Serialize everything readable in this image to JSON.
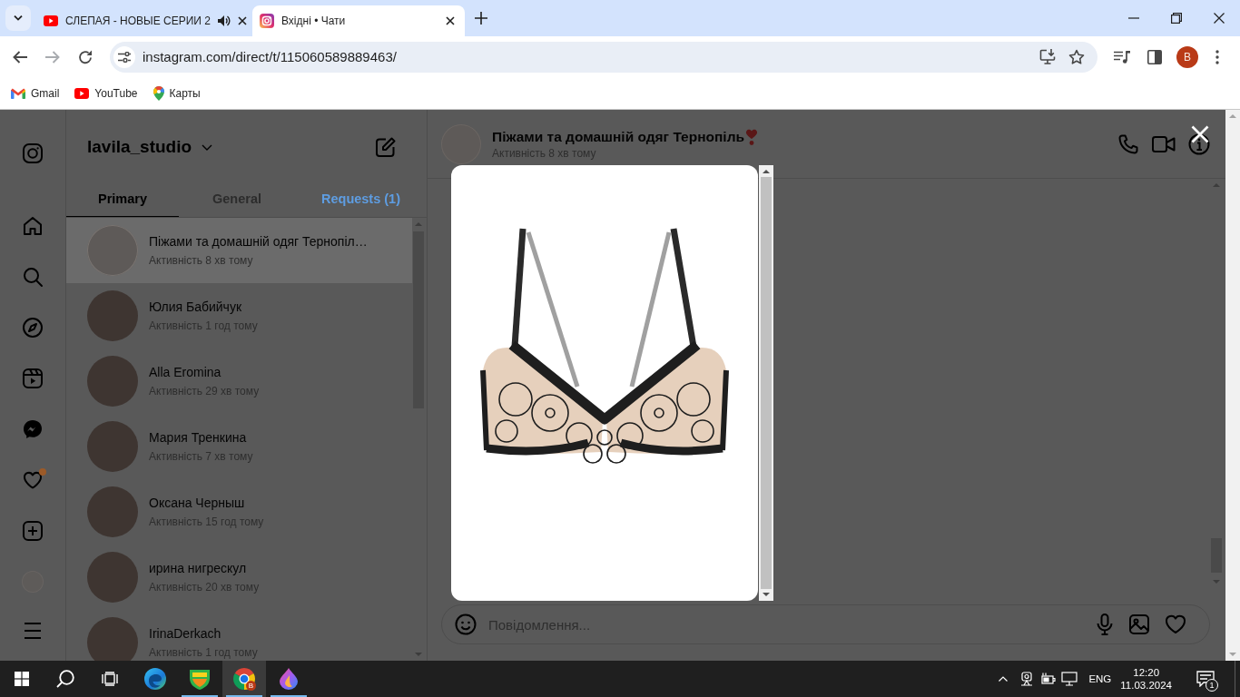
{
  "browser": {
    "tabs": [
      {
        "title": "СЛЕПАЯ - НОВЫЕ СЕРИИ 2",
        "kind": "youtube",
        "audio": true,
        "selected": false
      },
      {
        "title": "Вхідні • Чати",
        "kind": "instagram",
        "audio": false,
        "selected": true
      }
    ],
    "url": "instagram.com/direct/t/115060589889463/",
    "profile_initial": "B",
    "bookmarks": [
      {
        "label": "Gmail",
        "kind": "gmail"
      },
      {
        "label": "YouTube",
        "kind": "youtube"
      },
      {
        "label": "Карты",
        "kind": "maps"
      }
    ]
  },
  "nav": {
    "activity_dot": true
  },
  "inbox": {
    "account": "lavila_studio",
    "tabs": [
      {
        "label": "Primary",
        "selected": true,
        "highlighted": false
      },
      {
        "label": "General",
        "selected": false,
        "highlighted": false
      },
      {
        "label": "Requests (1)",
        "selected": false,
        "highlighted": true
      }
    ],
    "conversations": [
      {
        "name": "Піжами та домашній одяг Тернопіл…",
        "status": "Активність 8 хв тому",
        "kind": "logo",
        "selected": true
      },
      {
        "name": "Юлия Бабийчук",
        "status": "Активність 1 год тому",
        "kind": "photo",
        "selected": false
      },
      {
        "name": "Alla Eromina",
        "status": "Активність 29 хв тому",
        "kind": "photo",
        "selected": false
      },
      {
        "name": "Мария Тренкина",
        "status": "Активність 7 хв тому",
        "kind": "photo",
        "selected": false
      },
      {
        "name": "Оксана Черныш",
        "status": "Активність 15 год тому",
        "kind": "photo",
        "selected": false
      },
      {
        "name": "ирина нигрескул",
        "status": "Активність 20 хв тому",
        "kind": "photo",
        "selected": false
      },
      {
        "name": "IrinaDerkach",
        "status": "Активність 1 год тому",
        "kind": "photo",
        "selected": false
      }
    ]
  },
  "chat": {
    "title": "Піжами та домашній одяг Тернопіль",
    "status": "Активність 8 хв тому",
    "composer": {
      "placeholder": "Повідомлення..."
    }
  },
  "image_viewer": {
    "open": true
  },
  "taskbar": {
    "apps": [
      {
        "kind": "edge",
        "running": false,
        "selected": false
      },
      {
        "kind": "shield",
        "running": true,
        "selected": false
      },
      {
        "kind": "chrome",
        "running": true,
        "selected": true,
        "badge": "B"
      },
      {
        "kind": "drop",
        "running": true,
        "selected": false
      }
    ],
    "language": "ENG",
    "time": "12:20",
    "date": "11.03.2024",
    "notifications": "1"
  }
}
